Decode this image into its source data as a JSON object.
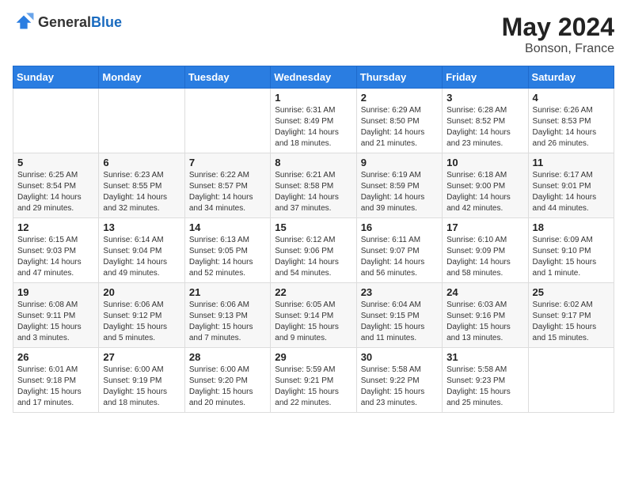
{
  "header": {
    "logo_general": "General",
    "logo_blue": "Blue",
    "month_year": "May 2024",
    "location": "Bonson, France"
  },
  "days_of_week": [
    "Sunday",
    "Monday",
    "Tuesday",
    "Wednesday",
    "Thursday",
    "Friday",
    "Saturday"
  ],
  "weeks": [
    [
      {
        "day": "",
        "info": ""
      },
      {
        "day": "",
        "info": ""
      },
      {
        "day": "",
        "info": ""
      },
      {
        "day": "1",
        "info": "Sunrise: 6:31 AM\nSunset: 8:49 PM\nDaylight: 14 hours and 18 minutes."
      },
      {
        "day": "2",
        "info": "Sunrise: 6:29 AM\nSunset: 8:50 PM\nDaylight: 14 hours and 21 minutes."
      },
      {
        "day": "3",
        "info": "Sunrise: 6:28 AM\nSunset: 8:52 PM\nDaylight: 14 hours and 23 minutes."
      },
      {
        "day": "4",
        "info": "Sunrise: 6:26 AM\nSunset: 8:53 PM\nDaylight: 14 hours and 26 minutes."
      }
    ],
    [
      {
        "day": "5",
        "info": "Sunrise: 6:25 AM\nSunset: 8:54 PM\nDaylight: 14 hours and 29 minutes."
      },
      {
        "day": "6",
        "info": "Sunrise: 6:23 AM\nSunset: 8:55 PM\nDaylight: 14 hours and 32 minutes."
      },
      {
        "day": "7",
        "info": "Sunrise: 6:22 AM\nSunset: 8:57 PM\nDaylight: 14 hours and 34 minutes."
      },
      {
        "day": "8",
        "info": "Sunrise: 6:21 AM\nSunset: 8:58 PM\nDaylight: 14 hours and 37 minutes."
      },
      {
        "day": "9",
        "info": "Sunrise: 6:19 AM\nSunset: 8:59 PM\nDaylight: 14 hours and 39 minutes."
      },
      {
        "day": "10",
        "info": "Sunrise: 6:18 AM\nSunset: 9:00 PM\nDaylight: 14 hours and 42 minutes."
      },
      {
        "day": "11",
        "info": "Sunrise: 6:17 AM\nSunset: 9:01 PM\nDaylight: 14 hours and 44 minutes."
      }
    ],
    [
      {
        "day": "12",
        "info": "Sunrise: 6:15 AM\nSunset: 9:03 PM\nDaylight: 14 hours and 47 minutes."
      },
      {
        "day": "13",
        "info": "Sunrise: 6:14 AM\nSunset: 9:04 PM\nDaylight: 14 hours and 49 minutes."
      },
      {
        "day": "14",
        "info": "Sunrise: 6:13 AM\nSunset: 9:05 PM\nDaylight: 14 hours and 52 minutes."
      },
      {
        "day": "15",
        "info": "Sunrise: 6:12 AM\nSunset: 9:06 PM\nDaylight: 14 hours and 54 minutes."
      },
      {
        "day": "16",
        "info": "Sunrise: 6:11 AM\nSunset: 9:07 PM\nDaylight: 14 hours and 56 minutes."
      },
      {
        "day": "17",
        "info": "Sunrise: 6:10 AM\nSunset: 9:09 PM\nDaylight: 14 hours and 58 minutes."
      },
      {
        "day": "18",
        "info": "Sunrise: 6:09 AM\nSunset: 9:10 PM\nDaylight: 15 hours and 1 minute."
      }
    ],
    [
      {
        "day": "19",
        "info": "Sunrise: 6:08 AM\nSunset: 9:11 PM\nDaylight: 15 hours and 3 minutes."
      },
      {
        "day": "20",
        "info": "Sunrise: 6:06 AM\nSunset: 9:12 PM\nDaylight: 15 hours and 5 minutes."
      },
      {
        "day": "21",
        "info": "Sunrise: 6:06 AM\nSunset: 9:13 PM\nDaylight: 15 hours and 7 minutes."
      },
      {
        "day": "22",
        "info": "Sunrise: 6:05 AM\nSunset: 9:14 PM\nDaylight: 15 hours and 9 minutes."
      },
      {
        "day": "23",
        "info": "Sunrise: 6:04 AM\nSunset: 9:15 PM\nDaylight: 15 hours and 11 minutes."
      },
      {
        "day": "24",
        "info": "Sunrise: 6:03 AM\nSunset: 9:16 PM\nDaylight: 15 hours and 13 minutes."
      },
      {
        "day": "25",
        "info": "Sunrise: 6:02 AM\nSunset: 9:17 PM\nDaylight: 15 hours and 15 minutes."
      }
    ],
    [
      {
        "day": "26",
        "info": "Sunrise: 6:01 AM\nSunset: 9:18 PM\nDaylight: 15 hours and 17 minutes."
      },
      {
        "day": "27",
        "info": "Sunrise: 6:00 AM\nSunset: 9:19 PM\nDaylight: 15 hours and 18 minutes."
      },
      {
        "day": "28",
        "info": "Sunrise: 6:00 AM\nSunset: 9:20 PM\nDaylight: 15 hours and 20 minutes."
      },
      {
        "day": "29",
        "info": "Sunrise: 5:59 AM\nSunset: 9:21 PM\nDaylight: 15 hours and 22 minutes."
      },
      {
        "day": "30",
        "info": "Sunrise: 5:58 AM\nSunset: 9:22 PM\nDaylight: 15 hours and 23 minutes."
      },
      {
        "day": "31",
        "info": "Sunrise: 5:58 AM\nSunset: 9:23 PM\nDaylight: 15 hours and 25 minutes."
      },
      {
        "day": "",
        "info": ""
      }
    ]
  ]
}
